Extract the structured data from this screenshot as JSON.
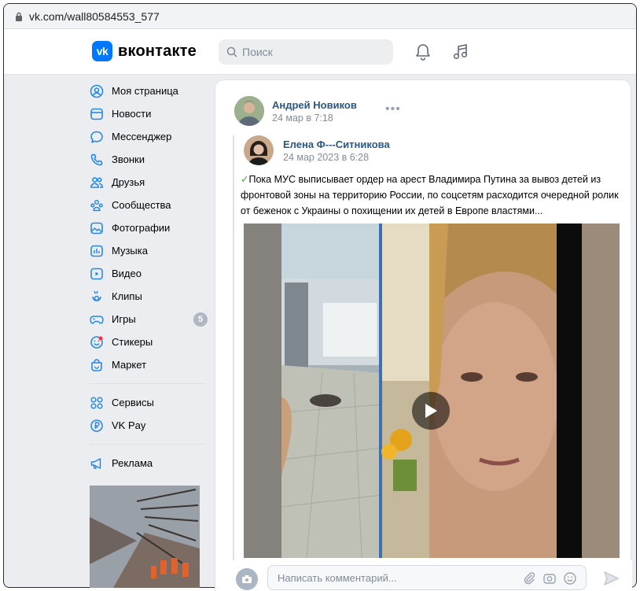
{
  "browser": {
    "url": "vk.com/wall80584553_577"
  },
  "header": {
    "logo_mark": "vk",
    "logo_text": "вконтакте",
    "search_placeholder": "Поиск",
    "icons": [
      "bell-icon",
      "music-note-icon"
    ]
  },
  "sidebar": {
    "items": [
      {
        "label": "Моя страница",
        "icon": "user-circle-icon"
      },
      {
        "label": "Новости",
        "icon": "news-icon"
      },
      {
        "label": "Мессенджер",
        "icon": "chat-bubble-icon"
      },
      {
        "label": "Звонки",
        "icon": "phone-icon"
      },
      {
        "label": "Друзья",
        "icon": "friends-icon"
      },
      {
        "label": "Сообщества",
        "icon": "communities-icon"
      },
      {
        "label": "Фотографии",
        "icon": "photo-icon"
      },
      {
        "label": "Музыка",
        "icon": "music-icon"
      },
      {
        "label": "Видео",
        "icon": "video-icon"
      },
      {
        "label": "Клипы",
        "icon": "clips-icon"
      },
      {
        "label": "Игры",
        "icon": "gamepad-icon",
        "badge": "5"
      },
      {
        "label": "Стикеры",
        "icon": "sticker-icon"
      },
      {
        "label": "Маркет",
        "icon": "market-bag-icon"
      }
    ],
    "services": [
      {
        "label": "Сервисы",
        "icon": "services-grid-icon"
      },
      {
        "label": "VK Pay",
        "icon": "vkpay-icon"
      }
    ],
    "ads": {
      "label": "Реклама",
      "icon": "megaphone-icon"
    }
  },
  "post": {
    "author": "Андрей Новиков",
    "date": "24 мар в 7:18",
    "more": "•••",
    "repost": {
      "author": "Елена Ф---Ситникова",
      "date": "24 мар 2023 в 6:28",
      "text_check": "✓",
      "text": "Пока МУС выписывает ордер на арест Владимира Путина за вывоз детей из фронтовой зоны на территорию России, по соцсетям расходится очередной ролик от беженок с Украины о похищении их детей в Европе властями..."
    }
  },
  "comment": {
    "placeholder": "Написать комментарий..."
  },
  "colors": {
    "brand": "#0077ff",
    "link": "#2a5885",
    "page_bg": "#ebedf0",
    "muted": "#818c99"
  }
}
